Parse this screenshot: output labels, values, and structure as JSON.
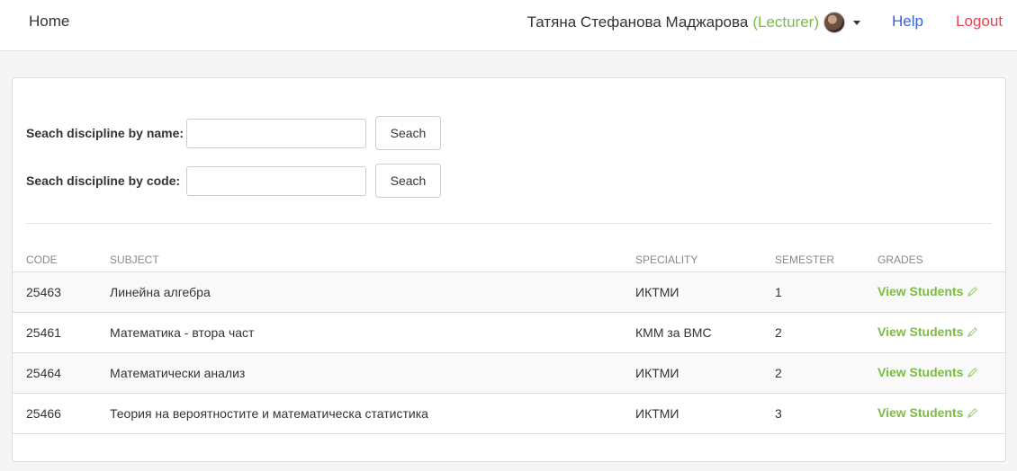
{
  "nav": {
    "home": "Home",
    "user_name": "Татяна Стефанова Маджарова",
    "user_role": "(Lecturer)",
    "help": "Help",
    "logout": "Logout"
  },
  "search": {
    "by_name_label": "Seach discipline by name:",
    "by_name_value": "",
    "by_name_button": "Seach",
    "by_code_label": "Seach discipline by code:",
    "by_code_value": "",
    "by_code_button": "Seach"
  },
  "table": {
    "headers": [
      "CODE",
      "SUBJECT",
      "SPECIALITY",
      "SEMESTER",
      "GRADES"
    ],
    "rows": [
      {
        "code": "25463",
        "subject": "Линейна алгебра",
        "speciality": "ИКТМИ",
        "semester": "1",
        "grades": "View Students"
      },
      {
        "code": "25461",
        "subject": "Математика - втора част",
        "speciality": "КММ за ВМС",
        "semester": "2",
        "grades": "View Students"
      },
      {
        "code": "25464",
        "subject": "Математически анализ",
        "speciality": "ИКТМИ",
        "semester": "2",
        "grades": "View Students"
      },
      {
        "code": "25466",
        "subject": "Теория на вероятностите и математическа статистика",
        "speciality": "ИКТМИ",
        "semester": "3",
        "grades": "View Students"
      }
    ]
  },
  "icons": {
    "grades_action": "pencil-icon",
    "user_menu": "caret-down-icon",
    "user_avatar": "avatar"
  },
  "colors": {
    "accent_green": "#7cbc43",
    "help_blue": "#3b63d8",
    "logout_red": "#e8414f"
  }
}
